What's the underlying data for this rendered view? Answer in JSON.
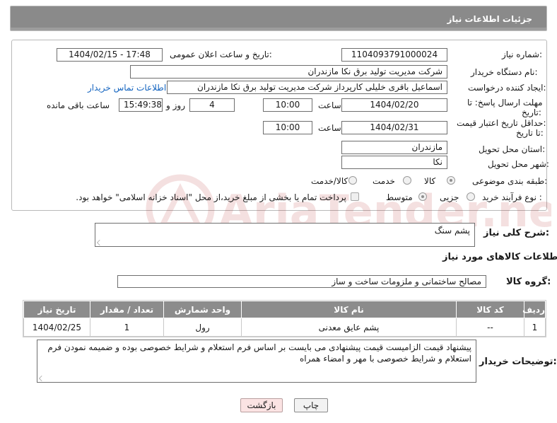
{
  "header": {
    "title": "جزئیات اطلاعات نیاز"
  },
  "form": {
    "need_number_label": "شماره نیاز:",
    "need_number": "1104093791000024",
    "announce_label": "تاریخ و ساعت اعلان عمومی:",
    "announce_value": "1404/02/15 - 17:48",
    "buyer_org_label": "نام دستگاه خریدار:",
    "buyer_org": "شرکت مدیریت تولید برق نکا  مازندران",
    "requester_label": "ایجاد کننده درخواست:",
    "requester": "اسماعیل باقری خلیلی کارپرداز شرکت مدیریت تولید برق نکا  مازندران",
    "contact_link": "اطلاعات تماس خریدار",
    "reply_deadline_label_1": "مهلت ارسال پاسخ: تا",
    "reply_deadline_label_2": "تاریخ:",
    "reply_date": "1404/02/20",
    "time_label": "ساعت",
    "reply_time": "10:00",
    "days_value": "4",
    "days_label": "روز و",
    "remaining_time": "15:49:38",
    "remaining_label": "ساعت باقی مانده",
    "validity_label_1": "حداقل تاریخ اعتبار قیمت:",
    "validity_label_2": "تا تاریخ:",
    "validity_date": "1404/02/31",
    "validity_time": "10:00",
    "province_label": "استان محل تحویل:",
    "province": "مازندران",
    "city_label": "شهر محل تحویل:",
    "city": "نکا",
    "category_label": "طبقه بندی موضوعی:",
    "category_options": [
      "کالا",
      "خدمت",
      "کالا/خدمت"
    ],
    "category_selected": "کالا",
    "process_label": "نوع فرآیند خرید :",
    "process_options": [
      "جزیی",
      "متوسط"
    ],
    "payment_note": "پرداخت تمام یا بخشی از مبلغ خرید،از محل \"اسناد خزانه اسلامی\" خواهد بود."
  },
  "description": {
    "label": "شرح کلی نیاز:",
    "value": "پشم سنگ"
  },
  "goods": {
    "section_title": "اطلاعات کالاهای مورد نیاز",
    "group_label": "گروه کالا:",
    "group_value": "مصالح ساختمانی و ملزومات ساخت و ساز",
    "columns": [
      "ردیف",
      "کد کالا",
      "نام کالا",
      "واحد شمارش",
      "تعداد / مقدار",
      "تاریخ نیاز"
    ],
    "rows": [
      [
        "1",
        "--",
        "پشم عایق معدنی",
        "رول",
        "1",
        "1404/02/25"
      ]
    ]
  },
  "buyer_notes": {
    "label": "توضیحات خریدار:",
    "value": "پیشنهاد قیمت الزامیست قیمت پیشنهادی می بایست بر اساس فرم استعلام و شرایط خصوصی بوده و ضمیمه نمودن فرم استعلام و شرایط خصوصی با مهر و امضاء همراه"
  },
  "buttons": {
    "print": "چاپ",
    "back": "بازگشت"
  },
  "watermark": {
    "text": "AriaTender.neT"
  },
  "colors": {
    "header_bg": "#8a8a8a",
    "table_header_bg": "#8c8c8c",
    "link": "#1565c0",
    "back_button_bg": "#fbe3e3"
  }
}
